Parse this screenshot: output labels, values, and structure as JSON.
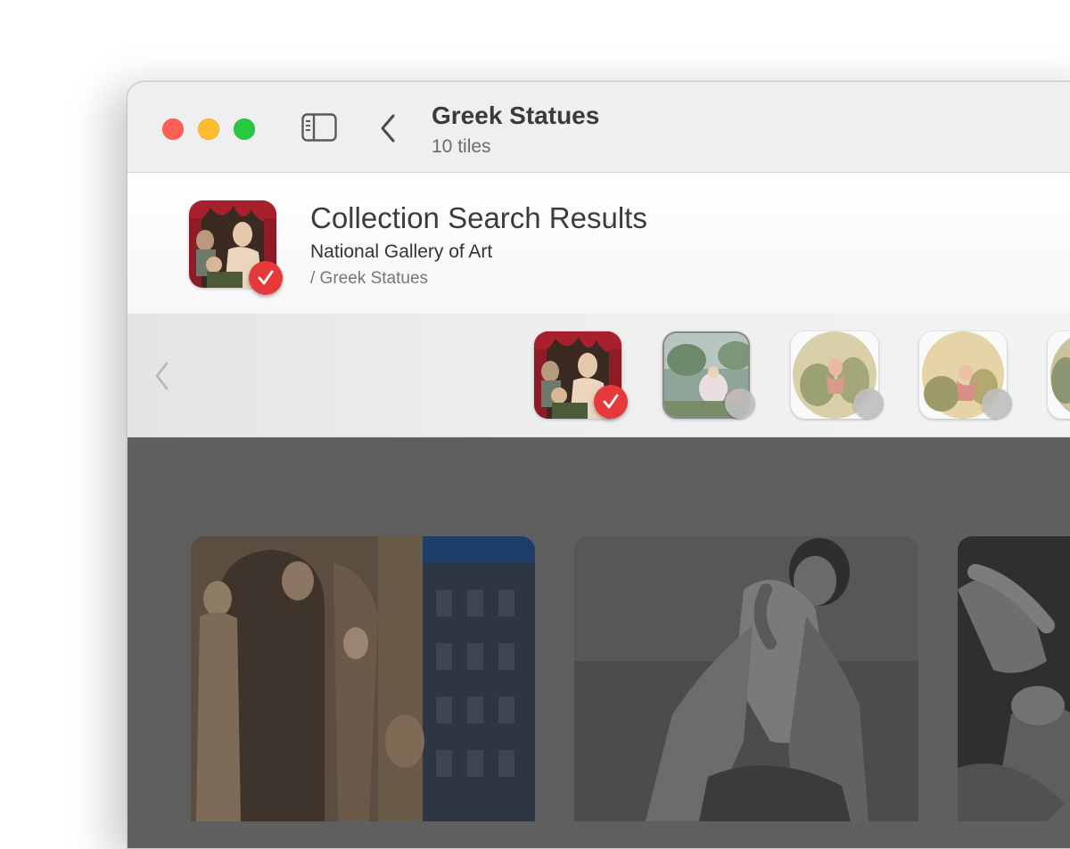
{
  "window": {
    "title": "Greek Statues",
    "subtitle": "10 tiles"
  },
  "icons": {
    "sidebar_toggle": "sidebar-icon",
    "back": "chevron-left-icon",
    "search": "search-icon",
    "check": "checkmark-icon"
  },
  "header": {
    "title": "Collection Search Results",
    "source": "National Gallery of Art",
    "path": "/ Greek Statues"
  },
  "strip": {
    "thumbnails": [
      {
        "name": "painting-renaissance-lady",
        "selected": true
      },
      {
        "name": "painting-rococo-garden",
        "selected": false
      },
      {
        "name": "painting-oval-cherub",
        "selected": false
      },
      {
        "name": "painting-oval-cherub-2",
        "selected": false
      },
      {
        "name": "painting-partial",
        "selected": false
      }
    ]
  },
  "tiles": [
    {
      "name": "opera-facade-sculptures"
    },
    {
      "name": "bronze-warrior-statue"
    },
    {
      "name": "marble-group-statue"
    }
  ],
  "colors": {
    "accent_red": "#e5393b",
    "traffic_red": "#ff5f57",
    "traffic_yellow": "#febc2e",
    "traffic_green": "#28c840",
    "grid_background": "#5f5f5f"
  }
}
